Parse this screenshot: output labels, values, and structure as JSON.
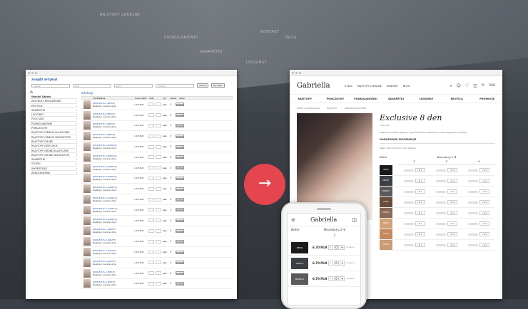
{
  "background": {
    "menu_words": [
      "RAJSTOPY LOKALNE",
      "KONTAKT",
      "BLOG",
      "PODKOLANÓWKI",
      "SKARPETKI",
      "LEGGINSY",
      "KOSZYK",
      "ZAKUPY"
    ]
  },
  "left_window": {
    "search_title": "znajdź artykuł",
    "inputs": [
      "nazwa",
      "kod",
      "kolor",
      "rozmiar"
    ],
    "search_button": "Szukaj",
    "clear_button": "Wyczyść",
    "sidebar_title": "Wyniki Szkoły",
    "sidebar": [
      "ARTYKUŁY REKLAMOWE",
      "EROTICA",
      "SKARPETKI",
      "LEGGINSY",
      "PLUS SIZE",
      "PODKOLANÓWKI",
      "PONCZOCHY",
      "RAJSTOPY CIENKIE KLASYCZNE",
      "RAJSTOPY CIENKIE WZORZYSTE",
      "RAJSTOPY GRUBE",
      "RAJSTOPY DZIECIĘCE",
      "RAJSTOPY GRUBE KLASYCZNE",
      "RAJSTOPY GRUBE WZORZYSTE",
      "SKARPETKI",
      "STOPKI",
      "WYPRZEDAŻ",
      "ZAKOLANÓWKI"
    ],
    "main_title": "artykuły",
    "columns": [
      "Kod/Nazwa",
      "Cena netto",
      "Ilość",
      "Jm",
      "Opak.",
      "dzien"
    ],
    "rows": [
      {
        "name": "[RDR-EXUS-1-BEIGE]",
        "sub": "Rajstopy cienkie idyle",
        "price": "1,05 PLN",
        "unit": "pak."
      },
      {
        "name": "[RDR-EXUS-2-BEIGE]",
        "sub": "Rajstopy cienkie idyle",
        "price": "1,05 PLN",
        "unit": "pak."
      },
      {
        "name": "[RDR-EXUS-3-BEIGE]",
        "sub": "Rajstopy cienkie idyle",
        "price": "1,05 PLN",
        "unit": "pak."
      },
      {
        "name": "[RDR-EXUS-4-BEIGE]",
        "sub": "Rajstopy cienkie idyle",
        "price": "1,05 PLN",
        "unit": "pak."
      },
      {
        "name": "[RDR-EXUS-1-BIANCO]",
        "sub": "Rajstopy cienkie idyle",
        "price": "1,05 PLN",
        "unit": "pak."
      },
      {
        "name": "[RDR-EXUS-2-BIANCO]",
        "sub": "Rajstopy cienkie idyle",
        "price": "1,05 PLN",
        "unit": "pak."
      },
      {
        "name": "[RDR-EXUS-3-BIANCO]",
        "sub": "Rajstopy cienkie idyle",
        "price": "1,05 PLN",
        "unit": "pak."
      },
      {
        "name": "[RDR-EXUS-4-BIANCO]",
        "sub": "Rajstopy cienkie idyle",
        "price": "1,05 PLN",
        "unit": "pak."
      },
      {
        "name": "[RDR-EXUS-1-GAZELA]",
        "sub": "Rajstopy cienkie idyle",
        "price": "1,05 PLN",
        "unit": "pak."
      },
      {
        "name": "[RDR-EXUS-2-GAZELA]",
        "sub": "Rajstopy cienkie idyle",
        "price": "1,05 PLN",
        "unit": "pak."
      },
      {
        "name": "[RDR-EXUS-3-GAZELA]",
        "sub": "Rajstopy cienkie idyle",
        "price": "1,05 PLN",
        "unit": "pak."
      },
      {
        "name": "[RDR-EXUS-4-GAZELA]",
        "sub": "Rajstopy cienkie idyle",
        "price": "1,05 PLN",
        "unit": "pak."
      },
      {
        "name": "[RDR-EXUS-1-GRAFIT]",
        "sub": "Rajstopy cienkie idyle",
        "price": "1,05 PLN",
        "unit": "pak."
      },
      {
        "name": "[RDR-EXUS-2-GRAFIT]",
        "sub": "Rajstopy cienkie idyle",
        "price": "1,05 PLN",
        "unit": "pak."
      },
      {
        "name": "[RDR-EXUS-3-GRAFIT]",
        "sub": "Rajstopy cienkie idyle",
        "price": "1,05 PLN",
        "unit": "pak."
      },
      {
        "name": "[RDR-EXUS-4-GRAFIT]",
        "sub": "Rajstopy cienkie idyle",
        "price": "1,05 PLN",
        "unit": "pak."
      },
      {
        "name": "[RDR-EXUS-1-MIELE]",
        "sub": "Rajstopy cienkie idyle",
        "price": "1,05 PLN",
        "unit": "pak."
      },
      {
        "name": "[RDR-EXUS-2-MIELE]",
        "sub": "Rajstopy cienkie idyle",
        "price": "1,05 PLN",
        "unit": "pak."
      }
    ],
    "row_button": "DODAJ"
  },
  "arrow": "→",
  "right_window": {
    "logo": "Gabriella",
    "nav": [
      "O NAS",
      "RAJSTOPY LOKALNE",
      "KONTAKT",
      "BLOG"
    ],
    "icons": [
      "search-icon",
      "user-icon",
      "heart-icon",
      "bag-icon"
    ],
    "lang": "PL",
    "lang2": "RUB",
    "menu": [
      "RAJSTOPY",
      "PONCZOCHY",
      "PODKOLANÓWKI",
      "SKARPETKI",
      "LEGGINSY",
      "EROTICA",
      "PROMOCJE"
    ],
    "crumbs": [
      "WRÓĆ DO KATALOGU",
      "RAJSTOPY",
      "CIENKIE KLASYCZNE"
    ],
    "title": "Exclusive 8 den",
    "code": "code 100",
    "desc": "Klasyczne cienkie rajstopy o grubości 8 den wykonane z wysokiej jakości przędzy.",
    "sub": "DODATKOWE INFORMACJE",
    "info": "Skład: 86% Poliamid, 14% Elastan",
    "kolor": "Kolor",
    "rozmiary": "Rozmiary 2-4",
    "sizes": [
      "2",
      "3",
      "4"
    ],
    "colors": [
      {
        "name": "NERO",
        "color": "#1a1a1a"
      },
      {
        "name": "GRAFIT",
        "color": "#3c4046"
      },
      {
        "name": "BIANCO",
        "color": "#5a5a5a"
      },
      {
        "name": "LYCRA",
        "color": "#6a4c3a"
      },
      {
        "name": "MOKKA",
        "color": "#8a6a56"
      },
      {
        "name": "BEIGE",
        "color": "#d1a27a"
      },
      {
        "name": "DAINO",
        "color": "#c48a5e"
      },
      {
        "name": "CAMEL",
        "color": "#c89c76"
      }
    ]
  },
  "phone": {
    "logo": "Gabriella",
    "kolor": "Kolor",
    "rozmiary": "Rozmiary 2-4",
    "size": "2",
    "rows": [
      {
        "name": "NERO",
        "color": "#1a1a1a",
        "price": "6,70 PLN",
        "qty": "0"
      },
      {
        "name": "GRAFIT",
        "color": "#3c4046",
        "price": "6,70 PLN",
        "qty": "0"
      },
      {
        "name": "BIANCO",
        "color": "#5a5a5a",
        "price": "6,70 PLN",
        "qty": "0"
      }
    ],
    "avail": "Dostępne"
  }
}
